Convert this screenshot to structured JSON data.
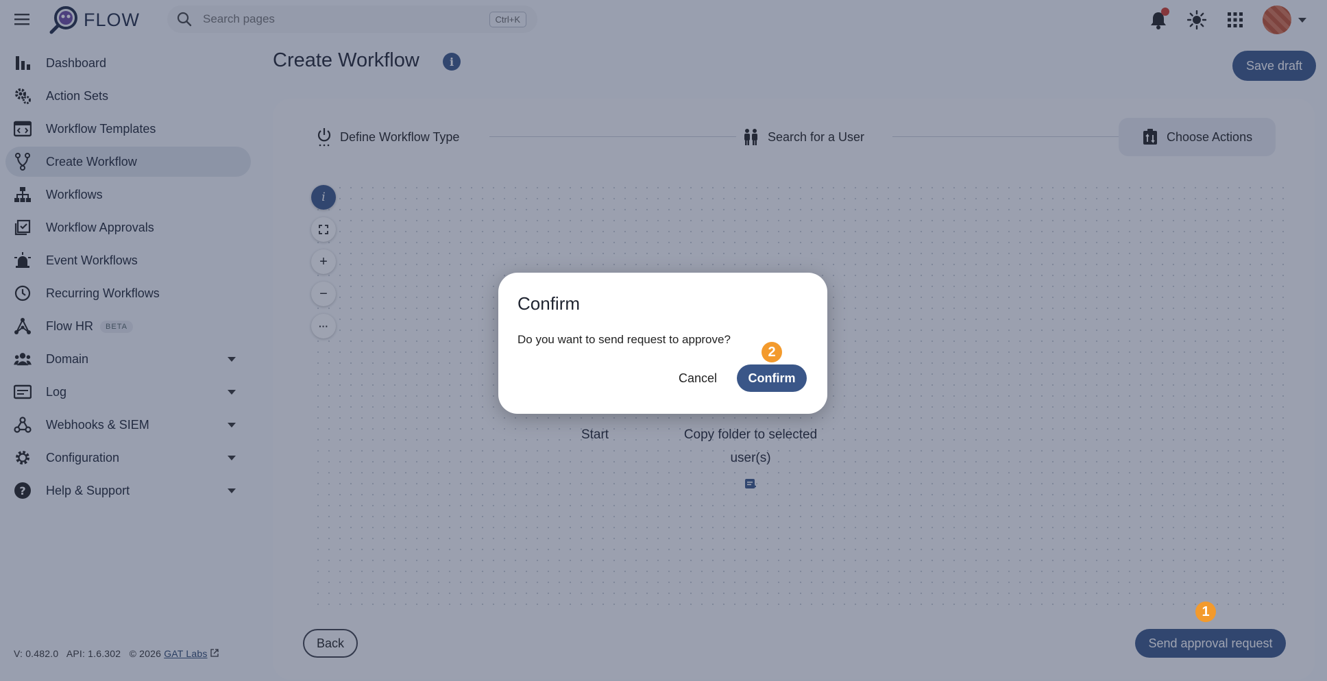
{
  "app": {
    "logo_text": "FLOW",
    "accent_color": "#3a5688",
    "badge_color": "#f39a2c"
  },
  "header": {
    "search_placeholder": "Search pages",
    "search_shortcut": "Ctrl+K",
    "icons": [
      "menu-icon",
      "bell-icon",
      "sun-icon",
      "apps-grid-icon",
      "avatar"
    ]
  },
  "sidebar": {
    "items": [
      {
        "label": "Dashboard",
        "icon": "bar-chart-icon"
      },
      {
        "label": "Action Sets",
        "icon": "gears-icon"
      },
      {
        "label": "Workflow Templates",
        "icon": "template-icon"
      },
      {
        "label": "Create Workflow",
        "icon": "fork-icon",
        "active": true
      },
      {
        "label": "Workflows",
        "icon": "hierarchy-icon"
      },
      {
        "label": "Workflow Approvals",
        "icon": "checklist-icon"
      },
      {
        "label": "Event Workflows",
        "icon": "alarm-icon"
      },
      {
        "label": "Recurring Workflows",
        "icon": "clock-icon"
      },
      {
        "label": "Flow HR",
        "icon": "network-icon",
        "badge": "BETA"
      },
      {
        "label": "Domain",
        "icon": "people-icon"
      },
      {
        "label": "Log",
        "icon": "log-icon"
      },
      {
        "label": "Webhooks & SIEM",
        "icon": "webhook-icon"
      },
      {
        "label": "Configuration",
        "icon": "gear-icon"
      },
      {
        "label": "Help & Support",
        "icon": "help-icon"
      }
    ],
    "version": "V: 0.482.0",
    "api": "API: 1.6.302",
    "copyright": "© 2026",
    "company_link": "GAT Labs"
  },
  "main": {
    "title": "Create Workflow",
    "save_draft": "Save draft",
    "steps": [
      {
        "label": "Define Workflow Type",
        "icon": "power-icon"
      },
      {
        "label": "Search for a User",
        "icon": "users-icon"
      },
      {
        "label": "Choose Actions",
        "icon": "actions-icon",
        "active": true
      }
    ],
    "canvas_controls": [
      "i",
      "+",
      "−",
      "···"
    ],
    "nodes": {
      "start": "Start",
      "action_line1": "Copy folder to selected",
      "action_line2": "user(s)"
    },
    "back": "Back",
    "send_approval": "Send approval request"
  },
  "dialog": {
    "title": "Confirm",
    "message": "Do you want to send request to approve?",
    "cancel": "Cancel",
    "confirm": "Confirm"
  },
  "annotations": {
    "badge_1": "1",
    "badge_2": "2"
  }
}
